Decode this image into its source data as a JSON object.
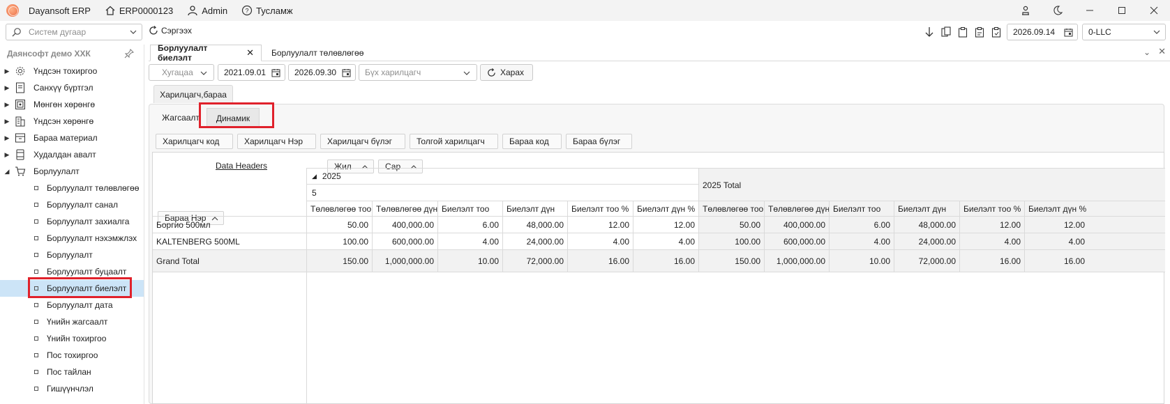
{
  "titlebar": {
    "app_name": "Dayansoft ERP",
    "doc_code": "ERP0000123",
    "user": "Admin",
    "help": "Тусламж"
  },
  "toolbar": {
    "system_placeholder": "Систем дугаар",
    "refresh": "Сэргээх",
    "date": "2026.09.14",
    "company": "0-LLC"
  },
  "sidebar": {
    "company": "Даянсофт демо ХХК",
    "groups": [
      {
        "label": "Үндсэн тохиргоо",
        "icon": "gear-icon"
      },
      {
        "label": "Санхүү бүртгэл",
        "icon": "ledger-icon"
      },
      {
        "label": "Мөнгөн хөрөнгө",
        "icon": "cash-icon"
      },
      {
        "label": "Үндсэн хөрөнгө",
        "icon": "building-icon"
      },
      {
        "label": "Бараа материал",
        "icon": "inventory-icon"
      },
      {
        "label": "Худалдан авалт",
        "icon": "purchase-icon"
      },
      {
        "label": "Борлуулалт",
        "icon": "cart-icon"
      }
    ],
    "children": [
      "Борлуулалт төлөвлөгөө",
      "Борлуулалт санал",
      "Борлуулалт захиалга",
      "Борлуулалт нэхэмжлэх",
      "Борлуулалт",
      "Борлуулалт буцаалт",
      "Борлуулалт биелэлт",
      "Борлуулалт дата",
      "Үнийн жагсаалт",
      "Үнийн тохиргоо",
      "Пос тохиргоо",
      "Пос тайлан",
      "Гишүүнчлэл"
    ],
    "selected_child": "Борлуулалт биелэлт"
  },
  "doc_tabs": [
    {
      "label": "Борлуулалт биелэлт",
      "active": true
    },
    {
      "label": "Борлуулалт төлөвлөгөө",
      "active": false
    }
  ],
  "filters": {
    "period": "Хугацаа",
    "date_from": "2021.09.01",
    "date_to": "2026.09.30",
    "partner_placeholder": "Бүх харилцагч",
    "view_button": "Харах"
  },
  "section_tab": "Харилцагч,бараа",
  "sub_tabs": [
    {
      "label": "Жагсаалт",
      "active": false
    },
    {
      "label": "Динамик",
      "active": true
    }
  ],
  "field_buttons": [
    "Харилцагч код",
    "Харилцагч Нэр",
    "Харилцагч бүлэг",
    "Толгой харилцагч",
    "Бараа код",
    "Бараа бүлэг"
  ],
  "pivot": {
    "data_headers": "Data Headers",
    "column_fields": [
      "Жил",
      "Сар"
    ],
    "row_field": "Бараа Нэр",
    "year": "2025",
    "month": "5",
    "year_total": "2025 Total",
    "measures": [
      "Төлөвлөгөө тоо",
      "Төлөвлөгөө дүн",
      "Биелэлт тоо",
      "Биелэлт дүн",
      "Биелэлт тоо %",
      "Биелэлт дүн %"
    ],
    "rows": [
      {
        "name": "Боргио 500мл",
        "values": [
          "50.00",
          "400,000.00",
          "6.00",
          "48,000.00",
          "12.00",
          "12.00"
        ],
        "totals": [
          "50.00",
          "400,000.00",
          "6.00",
          "48,000.00",
          "12.00",
          "12.00"
        ]
      },
      {
        "name": "KALTENBERG 500ML",
        "values": [
          "100.00",
          "600,000.00",
          "4.00",
          "24,000.00",
          "4.00",
          "4.00"
        ],
        "totals": [
          "100.00",
          "600,000.00",
          "4.00",
          "24,000.00",
          "4.00",
          "4.00"
        ]
      }
    ],
    "grand_total": {
      "name": "Grand Total",
      "values": [
        "150.00",
        "1,000,000.00",
        "10.00",
        "72,000.00",
        "16.00",
        "16.00"
      ],
      "totals": [
        "150.00",
        "1,000,000.00",
        "10.00",
        "72,000.00",
        "16.00",
        "16.00"
      ]
    }
  },
  "colors": {
    "highlight": "#e0212b",
    "selected_bg": "#cce4f7"
  }
}
